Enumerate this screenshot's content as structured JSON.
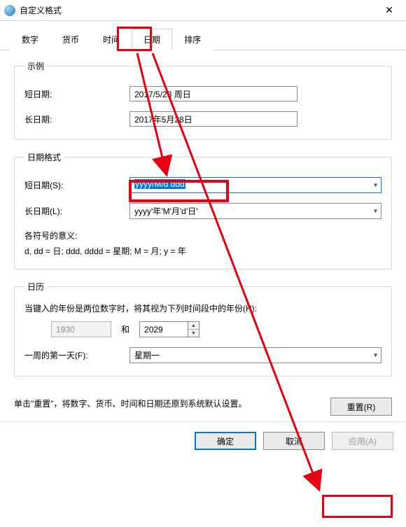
{
  "window": {
    "title": "自定义格式",
    "close_glyph": "✕"
  },
  "tabs": {
    "items": [
      "数字",
      "货币",
      "时间",
      "日期",
      "排序"
    ],
    "active_index": 3
  },
  "example": {
    "legend": "示例",
    "short_label": "短日期:",
    "short_value": "2017/5/28 周日",
    "long_label": "长日期:",
    "long_value": "2017年5月28日"
  },
  "format": {
    "legend": "日期格式",
    "short_label": "短日期(S):",
    "short_value": "yyyy/M/d ddd",
    "long_label": "长日期(L):",
    "long_value": "yyyy'年'M'月'd'日'",
    "meaning_label": "各符号的意义:",
    "meaning_text": "d, dd = 日;  ddd, dddd = 星期;  M = 月;  y = 年"
  },
  "calendar": {
    "legend": "日历",
    "two_digit_label": "当键入的年份是两位数字时，将其视为下列时间段中的年份(H):",
    "year_start": "1930",
    "and_label": "和",
    "year_end": "2029",
    "first_day_label": "一周的第一天(F):",
    "first_day_value": "星期一"
  },
  "footer": {
    "note": "单击\"重置\"，将数字、货币、时间和日期还原到系统默认设置。",
    "reset_label": "重置(R)",
    "ok_label": "确定",
    "cancel_label": "取消",
    "apply_label": "应用(A)"
  }
}
